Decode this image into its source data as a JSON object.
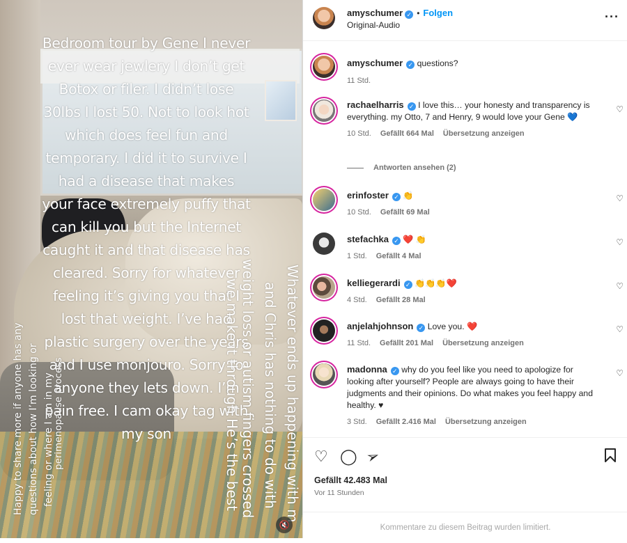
{
  "media": {
    "caption": "Bedroom tour by Gene  I never ever wear jewlery I don’t get Botox or filer. I didn’t lose 30lbs I lost  50. Not to look hot which does feel fun and temporary. I did it to survive I had a disease that makes your face extremely puffy that can kill you but the Internet caught it and that disease has cleared. Sorry for whatever feeling it’s giving you that I lost that weight. I’ve had plastic surgery over the years and I use monjouro. Sorry to anyone they lets down. I’m pain free. I cam okay tag with my son",
    "vertical_1": "Whatever ends up happening with m",
    "vertical_2": "and Chris has nothing to do with",
    "vertical_3": "weight loss or autism fingers crossed",
    "vertical_4": "we make it through He’s the best",
    "vertical_5": "perimenopause process",
    "vertical_6": "feeling or where I am in my",
    "vertical_7": "questions about how I’m looking or",
    "vertical_8": "Happy to share more if anyone has any",
    "mute_icon": "mute-icon"
  },
  "header": {
    "username": "amyschumer",
    "follow_label": "Folgen",
    "audio_label": "Original-Audio",
    "more_icon": "more-icon"
  },
  "caption_comment": {
    "username": "amyschumer",
    "text": "questions?",
    "time": "11 Std."
  },
  "comments": [
    {
      "username": "rachaelharris",
      "text": "I love this… your honesty and transparency is everything. my Otto, 7 and Henry, 9 would love your Gene 💙",
      "text2": "💙",
      "time": "10 Std.",
      "likes": "Gefällt 664 Mal",
      "translate": "Übersetzung anzeigen"
    },
    {
      "username": "erinfoster",
      "text": "👏",
      "time": "10 Std.",
      "likes": "Gefällt 69 Mal"
    },
    {
      "username": "stefachka",
      "text": "❤️ 👏",
      "time": "1 Std.",
      "likes": "Gefällt 4 Mal"
    },
    {
      "username": "kelliegerardi",
      "text": "👏👏👏❤️",
      "time": "4 Std.",
      "likes": "Gefällt 28 Mal"
    },
    {
      "username": "anjelahjohnson",
      "text": "Love you. ❤️",
      "time": "11 Std.",
      "likes": "Gefällt 201 Mal",
      "translate": "Übersetzung anzeigen"
    },
    {
      "username": "madonna",
      "text": "why do you feel like you need to apologize for looking after yourself? People are always going to have their judgments and their opinions. Do what makes you feel happy and healthy. ♥",
      "time": "3 Std.",
      "likes": "Gefällt 2.416 Mal",
      "translate": "Übersetzung anzeigen"
    }
  ],
  "replies_label": "Antworten ansehen (2)",
  "actions": {
    "likes": "Gefällt 42.483 Mal",
    "time": "Vor 11 Stunden",
    "limited": "Kommentare zu diesem Beitrag wurden limitiert."
  }
}
